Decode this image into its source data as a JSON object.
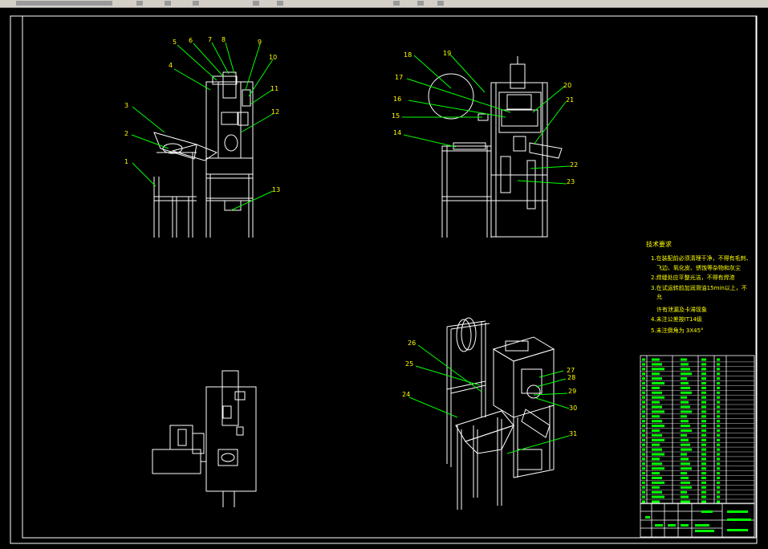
{
  "drawing": {
    "balloons": [
      "1",
      "2",
      "3",
      "4",
      "5",
      "6",
      "7",
      "8",
      "9",
      "10",
      "11",
      "12",
      "13",
      "14",
      "15",
      "16",
      "17",
      "18",
      "19",
      "20",
      "21",
      "22",
      "23",
      "24",
      "25",
      "26",
      "27",
      "28",
      "29",
      "30",
      "31"
    ],
    "tech_req": {
      "title": "技术要求",
      "line1": "1.在装配前必须清理干净，不得有毛刺、",
      "line1b": "飞边、氧化皮、锈蚀等杂物和灰尘",
      "line2": "2.焊缝处应平整光洁，不得有焊渣",
      "line3": "3.在试运转前加润滑油15min以上，不",
      "line3b": "允",
      "line3c": "许有泄漏及卡滞现象",
      "line4": "4.未注公差按IT14级",
      "line5": "5.未注倒角为 3X45°"
    }
  },
  "colors": {
    "line": "#ffffff",
    "leader": "#00ff00",
    "label": "#ffff00",
    "frame": "#ffffff",
    "fill": "#00ff00",
    "background": "#000000"
  }
}
